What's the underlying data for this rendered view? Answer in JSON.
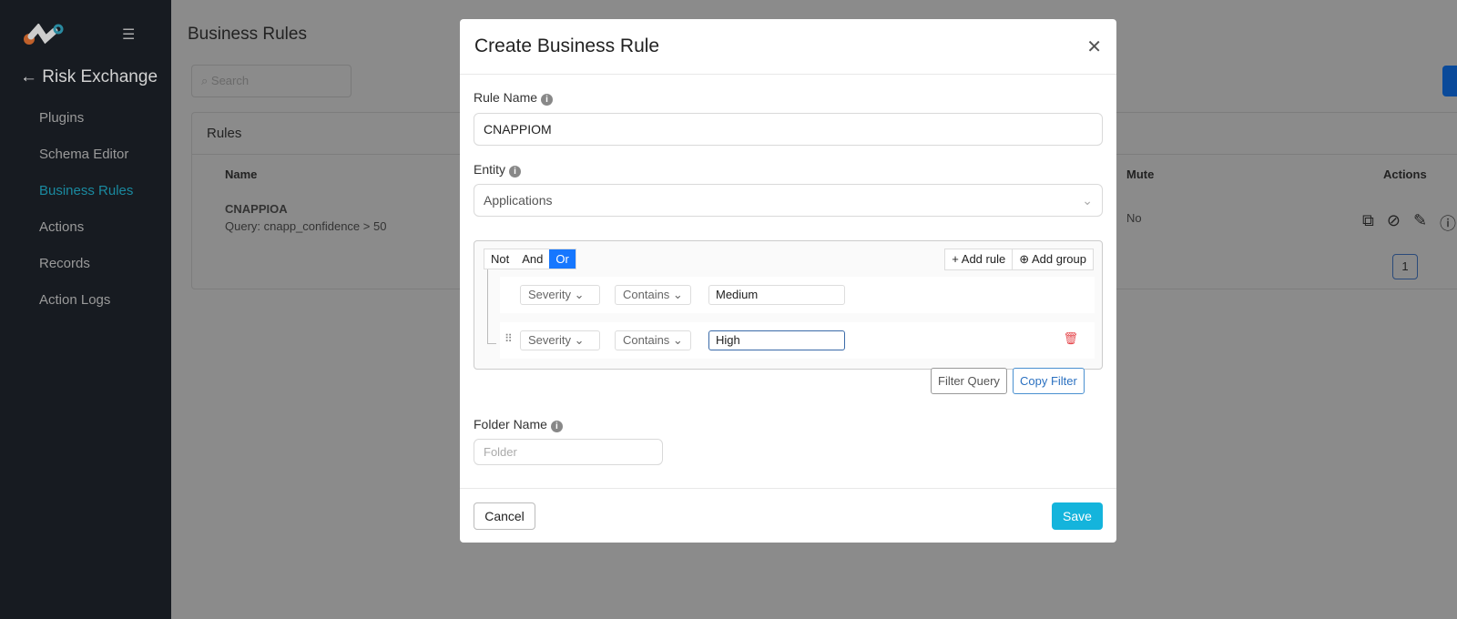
{
  "sidebar": {
    "back_label": "Risk Exchange",
    "items": [
      {
        "label": "Plugins"
      },
      {
        "label": "Schema Editor"
      },
      {
        "label": "Business Rules",
        "active": true
      },
      {
        "label": "Actions"
      },
      {
        "label": "Records"
      },
      {
        "label": "Action Logs"
      }
    ]
  },
  "page": {
    "title": "Business Rules",
    "search_placeholder": "Search",
    "card_title": "Rules",
    "columns": [
      "Name",
      "Mute",
      "Actions"
    ],
    "rows": [
      {
        "name": "CNAPPIOA",
        "query": "Query: cnapp_confidence > 50",
        "mute": "No"
      }
    ],
    "current_page": "1"
  },
  "modal": {
    "title": "Create Business Rule",
    "rule_name_label": "Rule Name",
    "rule_name_value": "CNAPPIOM",
    "entity_label": "Entity",
    "entity_value": "Applications",
    "combinators": [
      "Not",
      "And",
      "Or"
    ],
    "active_combinator": "Or",
    "add_rule": "Add rule",
    "add_group": "Add group",
    "rules": [
      {
        "field": "Severity",
        "operator": "Contains",
        "value": "Medium"
      },
      {
        "field": "Severity",
        "operator": "Contains",
        "value": "High"
      }
    ],
    "filter_query": "Filter Query",
    "copy_filter": "Copy Filter",
    "folder_label": "Folder Name",
    "folder_placeholder": "Folder",
    "cancel": "Cancel",
    "save": "Save"
  },
  "colors": {
    "accent": "#14b4dc",
    "active_nav": "#1a8aa0",
    "combinator_active": "#1677ff",
    "delete": "#e5484d"
  }
}
